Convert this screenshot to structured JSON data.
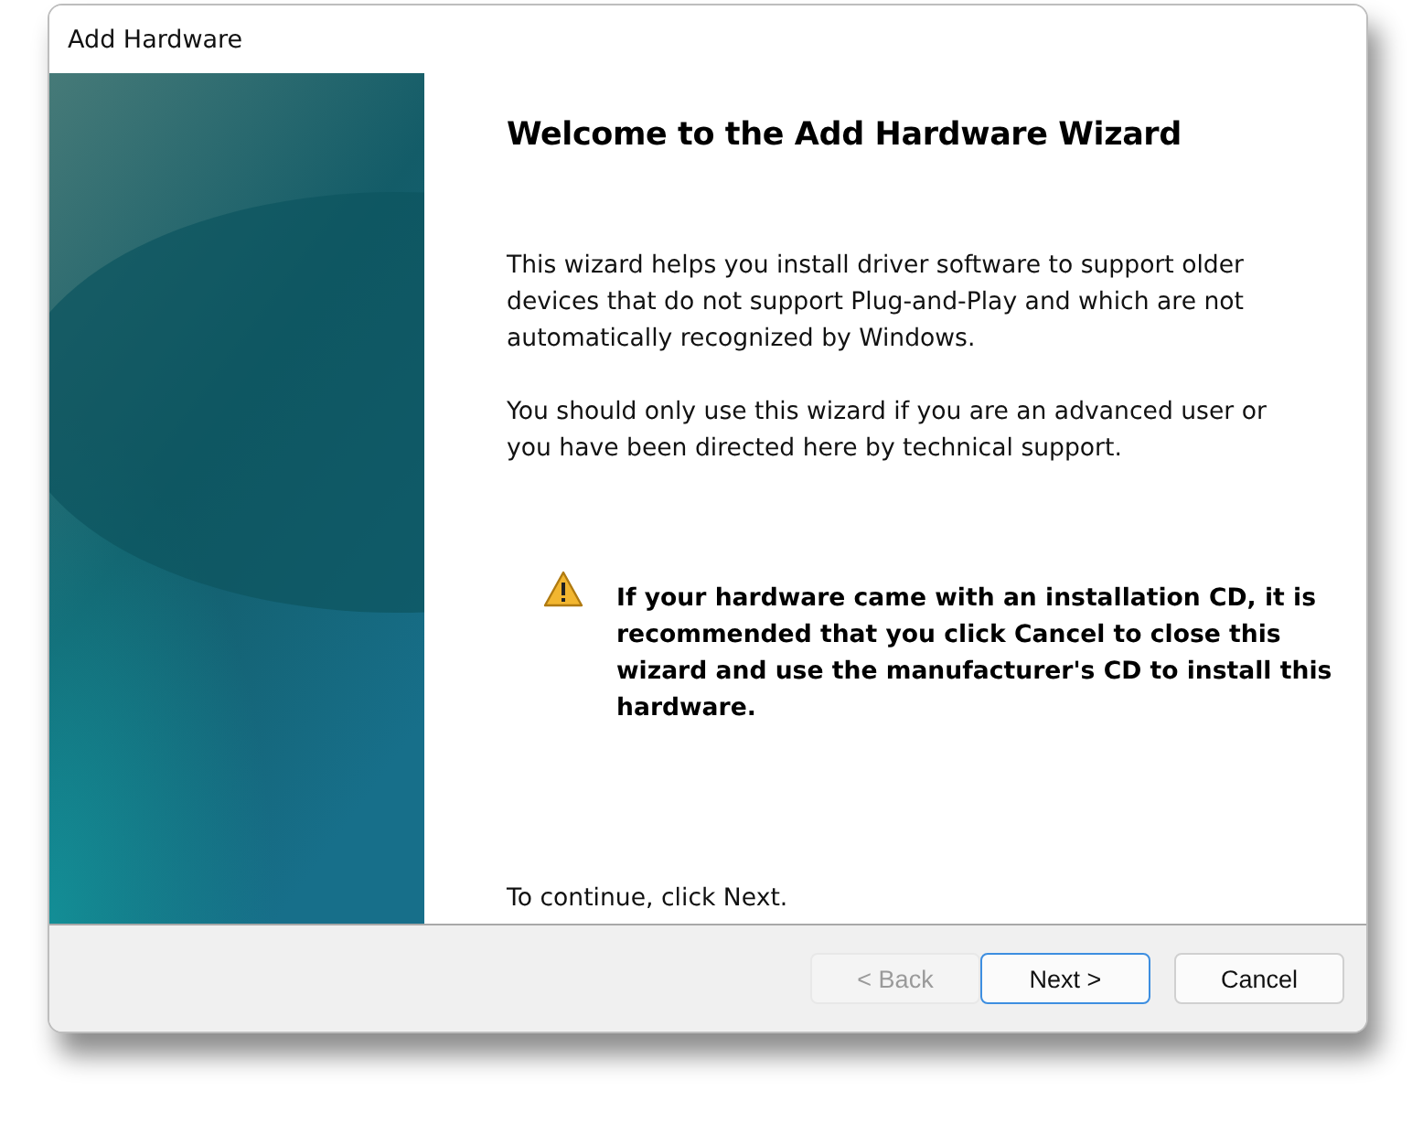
{
  "window": {
    "title": "Add Hardware"
  },
  "heading": "Welcome to the Add Hardware Wizard",
  "paragraphs": [
    "This wizard helps you install driver software to support older devices that do not support Plug-and-Play and which are not automatically recognized by Windows.",
    "You should only use this wizard if you are an advanced user or you have been directed here by technical support."
  ],
  "warning": {
    "text": "If your hardware came with an installation CD, it is recommended that you click Cancel to close this wizard and use the manufacturer's CD to install this hardware."
  },
  "footer_text": "To continue, click Next.",
  "buttons": [
    {
      "label": "< Back",
      "disabled": true,
      "default": false
    },
    {
      "label": "Next >",
      "disabled": false,
      "default": true
    },
    {
      "label": "Cancel",
      "disabled": false,
      "default": false
    }
  ]
}
